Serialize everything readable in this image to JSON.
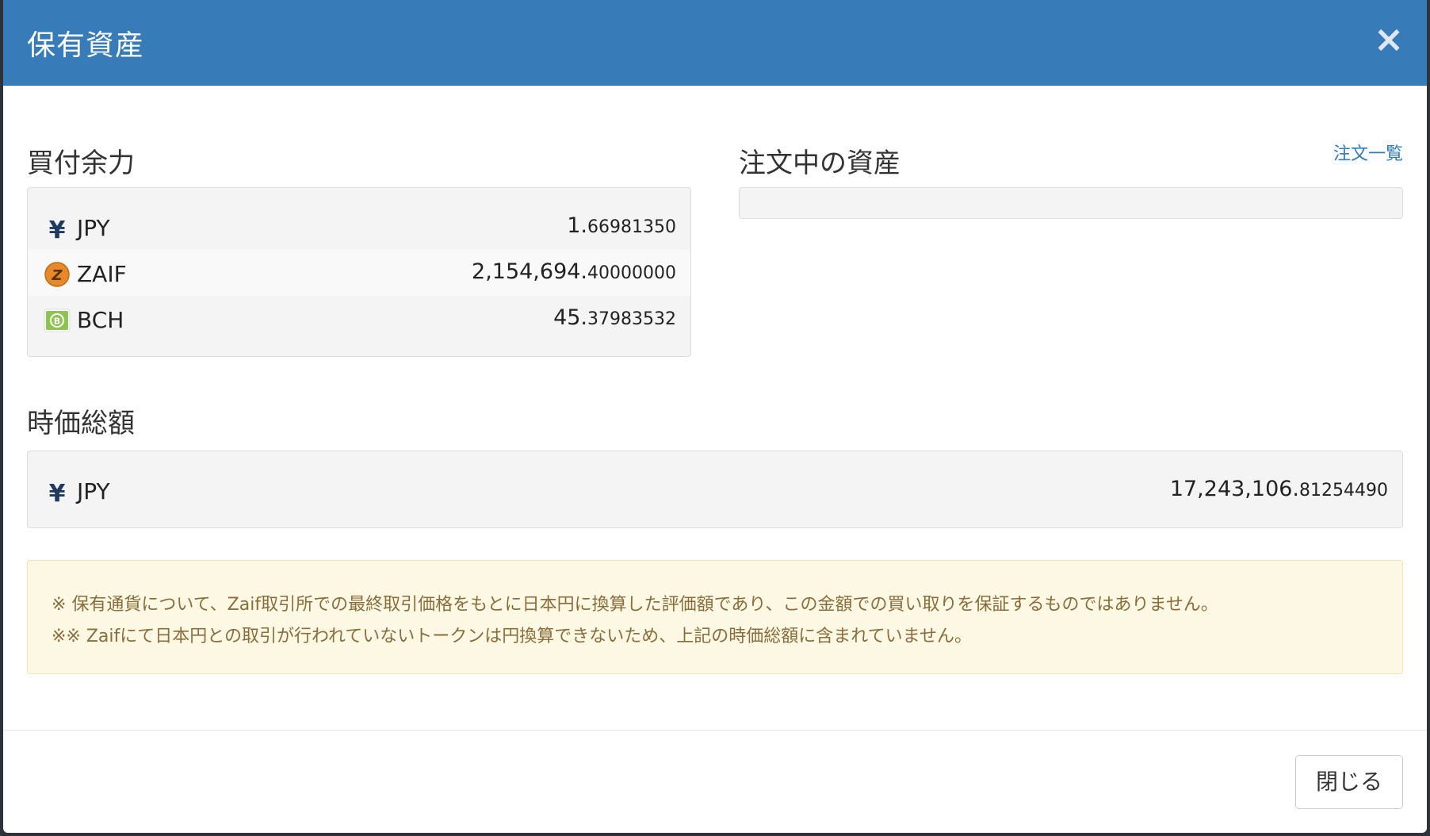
{
  "modal": {
    "title": "保有資産",
    "close_symbol": "×"
  },
  "buying_power": {
    "title": "買付余力",
    "assets": [
      {
        "symbol": "JPY",
        "amount_int": "1.",
        "amount_frac": "66981350",
        "icon": "yen-icon"
      },
      {
        "symbol": "ZAIF",
        "amount_int": "2,154,694.",
        "amount_frac": "40000000",
        "icon": "zaif-coin-icon"
      },
      {
        "symbol": "BCH",
        "amount_int": "45.",
        "amount_frac": "37983532",
        "icon": "bch-icon"
      }
    ]
  },
  "orders": {
    "title": "注文中の資産",
    "link_label": "注文一覧"
  },
  "market_value": {
    "title": "時価総額",
    "symbol": "JPY",
    "amount_int": "17,243,106.",
    "amount_frac": "81254490"
  },
  "notice": {
    "line1": "※ 保有通貨について、Zaif取引所での最終取引価格をもとに日本円に換算した評価額であり、この金額での買い取りを保証するものではありません。",
    "line2": "※※ Zaifにて日本円との取引が行われていないトークンは円換算できないため、上記の時価総額に含まれていません。"
  },
  "footer": {
    "close_label": "閉じる"
  },
  "colors": {
    "header": "#377bb8",
    "panel": "#f4f4f4",
    "notice_bg": "#fcf8e3",
    "notice_text": "#8a6d3b",
    "link": "#2f7ac0",
    "zaif_orange": "#e5892a",
    "bch_green": "#8dc351"
  }
}
